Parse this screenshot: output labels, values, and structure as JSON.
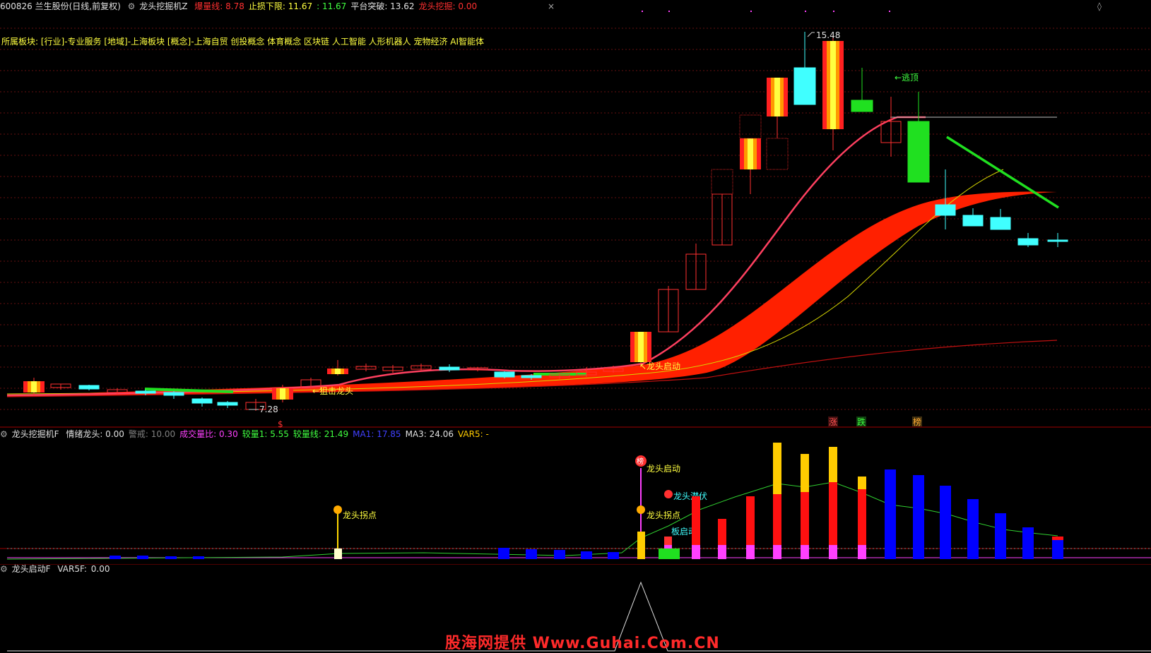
{
  "header": {
    "stock": "600826 兰生股份(日线,前复权)",
    "indicator": "龙头挖掘机Z",
    "items": [
      {
        "label": "爆量线:",
        "value": "8.78",
        "color": "#ff3030"
      },
      {
        "label": "止损下限:",
        "value": "11.67",
        "color": "#ffff40"
      },
      {
        "label": ":",
        "value": "11.67",
        "color": "#40ff40"
      },
      {
        "label": "平台突破:",
        "value": "13.62",
        "color": "#e0e0e0"
      },
      {
        "label": "龙头挖掘:",
        "value": "0.00",
        "color": "#ff3030"
      }
    ]
  },
  "sector": "所属板块: [行业]-专业服务 [地域]-上海板块 [概念]-上海自贸 创投概念 体育概念 区块链 人工智能 人形机器人 宠物经济 AI智能体",
  "main_labels": {
    "high": "15.48",
    "low": "7.28",
    "escape": "←逃顶",
    "dragon_start": "↖龙头启动",
    "snipe": "←狙击龙头",
    "dollar": "$",
    "tag_up": "涨",
    "tag_down": "跌",
    "tag_list": "榜"
  },
  "vol_header": {
    "name": "龙头挖掘机F",
    "items": [
      {
        "label": "情绪龙头:",
        "value": "0.00",
        "color": "#e0e0e0"
      },
      {
        "label": "警戒:",
        "value": "10.00",
        "color": "#808080"
      },
      {
        "label": "成交量比:",
        "value": "0.30",
        "color": "#ff40ff"
      },
      {
        "label": "较量1:",
        "value": "5.55",
        "color": "#40ff40"
      },
      {
        "label": "较量线:",
        "value": "21.49",
        "color": "#40ff40"
      },
      {
        "label": "MA1:",
        "value": "17.85",
        "color": "#4040ff"
      },
      {
        "label": "MA3:",
        "value": "24.06",
        "color": "#e0e0e0"
      },
      {
        "label": "VAR5:",
        "value": "-",
        "color": "#ffcc00"
      }
    ]
  },
  "vol_labels": {
    "point1": "龙头拐点",
    "point2": "龙头拐点",
    "start": "龙头启动",
    "ambush": "龙头潜伏",
    "board": "板启动",
    "badge_list": "榜",
    "badge_go": "龙"
  },
  "ind_header": {
    "name": "龙头启动F",
    "label": "VAR5F:",
    "value": "0.00"
  },
  "watermark": "股海网提供 Www.Guhai.Com.CN",
  "colors": {
    "up": "#ff3030",
    "down": "#40ffff",
    "green": "#00e000",
    "band": "#ff2000",
    "ma_red": "#ff4060",
    "ma_yellow": "#d8d800"
  }
}
